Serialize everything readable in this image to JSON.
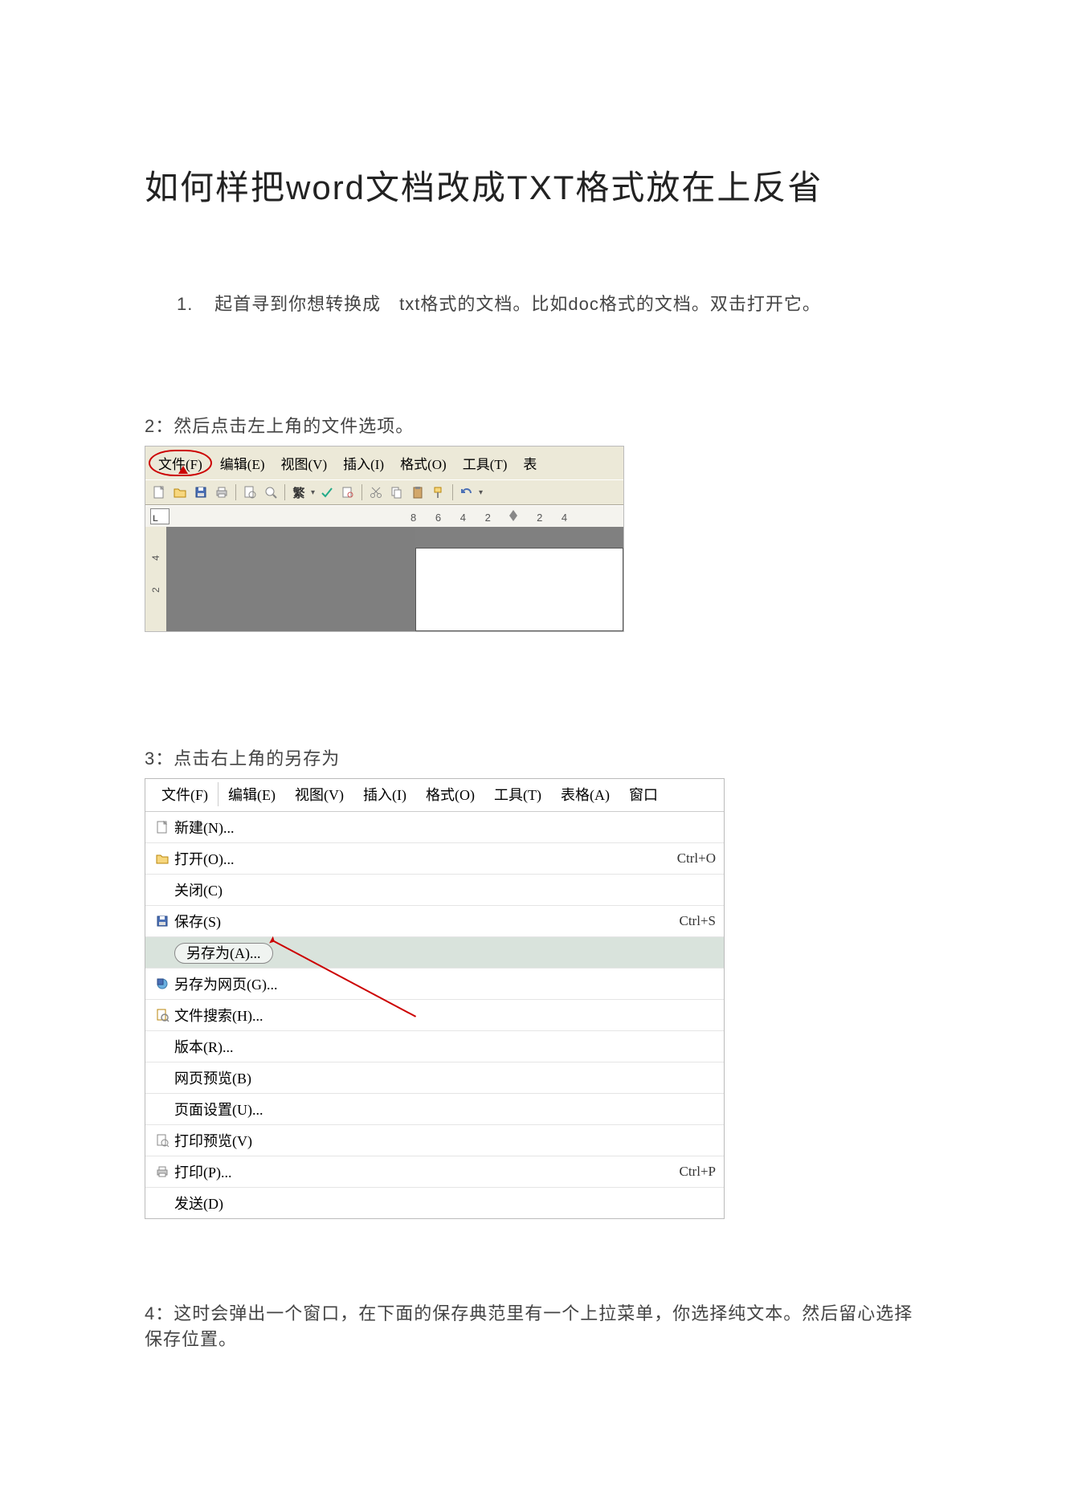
{
  "title": "如何样把word文档改成TXT格式放在上反省",
  "step1": {
    "num": "1.",
    "text": "起首寻到你想转换成　txt格式的文档。比如doc格式的文档。双击打开它。"
  },
  "step2": {
    "text": "2：然后点击左上角的文件选项。"
  },
  "step3": {
    "text": "3：点击右上角的另存为"
  },
  "step4": {
    "text": "4：这时会弹出一个窗口，在下面的保存典范里有一个上拉菜单，你选择纯文本。然后留心选择保存位置。"
  },
  "shot1": {
    "menus": [
      "文件(F)",
      "编辑(E)",
      "视图(V)",
      "插入(I)",
      "格式(O)",
      "工具(T)",
      "表"
    ],
    "ruler_numbers": [
      "8",
      "6",
      "4",
      "2",
      "2",
      "4"
    ],
    "vruler": [
      "4",
      "2"
    ],
    "toolbar_text": "繁",
    "ruler_corner": "L"
  },
  "shot2": {
    "menus": [
      "文件(F)",
      "编辑(E)",
      "视图(V)",
      "插入(I)",
      "格式(O)",
      "工具(T)",
      "表格(A)",
      "窗口"
    ],
    "items": [
      {
        "label": "新建(N)...",
        "shortcut": "",
        "icon": "new"
      },
      {
        "label": "打开(O)...",
        "shortcut": "Ctrl+O",
        "icon": "open"
      },
      {
        "label": "关闭(C)",
        "shortcut": "",
        "icon": ""
      },
      {
        "label": "保存(S)",
        "shortcut": "Ctrl+S",
        "icon": "save"
      },
      {
        "label": "另存为(A)...",
        "shortcut": "",
        "icon": "",
        "highlight": true
      },
      {
        "label": "另存为网页(G)...",
        "shortcut": "",
        "icon": "saveweb"
      },
      {
        "label": "文件搜索(H)...",
        "shortcut": "",
        "icon": "search"
      },
      {
        "label": "版本(R)...",
        "shortcut": "",
        "icon": ""
      },
      {
        "label": "网页预览(B)",
        "shortcut": "",
        "icon": ""
      },
      {
        "label": "页面设置(U)...",
        "shortcut": "",
        "icon": ""
      },
      {
        "label": "打印预览(V)",
        "shortcut": "",
        "icon": "preview"
      },
      {
        "label": "打印(P)...",
        "shortcut": "Ctrl+P",
        "icon": "print"
      },
      {
        "label": "发送(D)",
        "shortcut": "",
        "icon": ""
      }
    ]
  }
}
